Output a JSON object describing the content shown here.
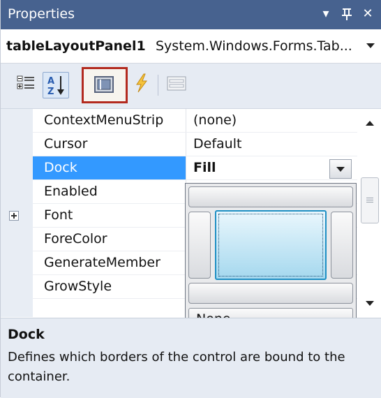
{
  "titlebar": {
    "title": "Properties",
    "dropdown_glyph": "▾",
    "pin_glyph": "⊥",
    "close_glyph": "✕"
  },
  "object_selector": {
    "name": "tableLayoutPanel1",
    "type": "System.Windows.Forms.Tab..."
  },
  "toolbar": {
    "buttons": [
      {
        "icon": "categorized-icon"
      },
      {
        "icon": "alphabetical-sort-icon"
      },
      {
        "icon": "properties-icon",
        "selected": true
      },
      {
        "icon": "events-lightning-icon"
      },
      {
        "icon": "property-pages-icon"
      }
    ]
  },
  "grid": {
    "rows": [
      {
        "name": "ContextMenuStrip",
        "value": "(none)"
      },
      {
        "name": "Cursor",
        "value": "Default"
      },
      {
        "name": "Dock",
        "value": "Fill",
        "selected": true
      },
      {
        "name": "Enabled",
        "value": ""
      },
      {
        "name": "Font",
        "value": "",
        "expandable": true
      },
      {
        "name": "ForeColor",
        "value": ""
      },
      {
        "name": "GenerateMember",
        "value": ""
      },
      {
        "name": "GrowStyle",
        "value": ""
      }
    ]
  },
  "dock_editor": {
    "none_label": "None"
  },
  "description": {
    "title": "Dock",
    "text": "Defines which borders of the control are bound to the container."
  },
  "colors": {
    "titlebar": "#47628f",
    "selection": "#3399ff",
    "highlight": "#b32a1f"
  }
}
